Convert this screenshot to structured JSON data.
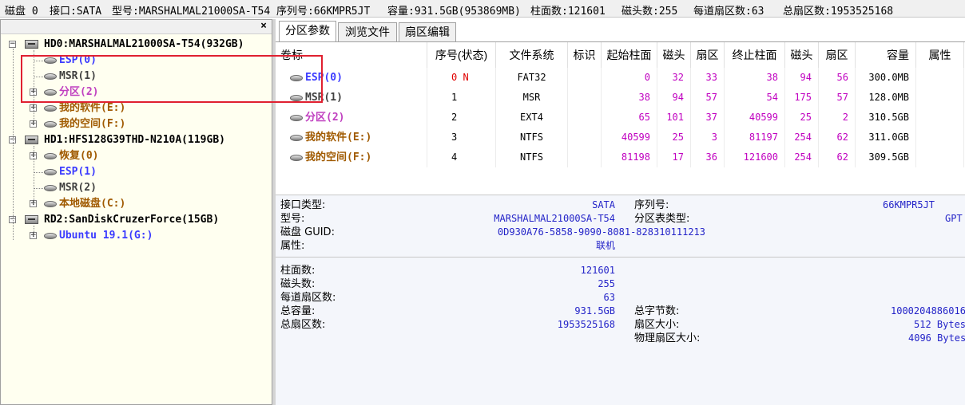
{
  "infobar": {
    "disk": "磁盘 0",
    "interface": "接口:SATA",
    "model": "型号:MARSHALMAL21000SA-T54",
    "serial": "序列号:66KMPR5JT",
    "capacity": "容量:931.5GB(953869MB)",
    "cylinders": "柱面数:121601",
    "heads": "磁头数:255",
    "sectors_per_track": "每道扇区数:63",
    "total_sectors": "总扇区数:1953525168"
  },
  "tree": {
    "close": "×",
    "disks": [
      {
        "label": "HD0:MARSHALMAL21000SA-T54(932GB)",
        "children": [
          {
            "label": "ESP(0)",
            "color": "#3a3aff"
          },
          {
            "label": "MSR(1)",
            "color": "#404040"
          },
          {
            "label": "分区(2)",
            "color": "#c040c0"
          },
          {
            "label": "我的软件(E:)",
            "color": "#a05a00"
          },
          {
            "label": "我的空间(F:)",
            "color": "#a05a00"
          }
        ]
      },
      {
        "label": "HD1:HFS128G39THD-N210A(119GB)",
        "children": [
          {
            "label": "恢复(0)",
            "color": "#a05a00"
          },
          {
            "label": "ESP(1)",
            "color": "#3a3aff"
          },
          {
            "label": "MSR(2)",
            "color": "#404040"
          },
          {
            "label": "本地磁盘(C:)",
            "color": "#a05a00"
          }
        ]
      },
      {
        "label": "RD2:SanDiskCruzerForce(15GB)",
        "children": [
          {
            "label": "Ubuntu 19.1(G:)",
            "color": "#3a3aff"
          }
        ]
      }
    ]
  },
  "tabs": [
    "分区参数",
    "浏览文件",
    "扇区编辑"
  ],
  "table": {
    "headers": [
      "卷标",
      "序号(状态)",
      "文件系统",
      "标识",
      "起始柱面",
      "磁头",
      "扇区",
      "终止柱面",
      "磁头",
      "扇区",
      "容量",
      "属性"
    ],
    "rows": [
      {
        "label": "ESP(0)",
        "label_color": "#3a3aff",
        "index": "0 N",
        "index_color": "#e00000",
        "fs": "FAT32",
        "id": "",
        "start_cyl": "0",
        "start_head": "32",
        "start_sec": "33",
        "end_cyl": "38",
        "end_head": "94",
        "end_sec": "56",
        "size": "300.0MB",
        "attr": ""
      },
      {
        "label": "MSR(1)",
        "label_color": "#404040",
        "index": "1",
        "index_color": "#000000",
        "fs": "MSR",
        "id": "",
        "start_cyl": "38",
        "start_head": "94",
        "start_sec": "57",
        "end_cyl": "54",
        "end_head": "175",
        "end_sec": "57",
        "size": "128.0MB",
        "attr": ""
      },
      {
        "label": "分区(2)",
        "label_color": "#c040c0",
        "index": "2",
        "index_color": "#000000",
        "fs": "EXT4",
        "id": "",
        "start_cyl": "65",
        "start_head": "101",
        "start_sec": "37",
        "end_cyl": "40599",
        "end_head": "25",
        "end_sec": "2",
        "size": "310.5GB",
        "attr": ""
      },
      {
        "label": "我的软件(E:)",
        "label_color": "#a05a00",
        "index": "3",
        "index_color": "#000000",
        "fs": "NTFS",
        "id": "",
        "start_cyl": "40599",
        "start_head": "25",
        "start_sec": "3",
        "end_cyl": "81197",
        "end_head": "254",
        "end_sec": "62",
        "size": "311.0GB",
        "attr": ""
      },
      {
        "label": "我的空间(F:)",
        "label_color": "#a05a00",
        "index": "4",
        "index_color": "#000000",
        "fs": "NTFS",
        "id": "",
        "start_cyl": "81198",
        "start_head": "17",
        "start_sec": "36",
        "end_cyl": "121600",
        "end_head": "254",
        "end_sec": "62",
        "size": "309.5GB",
        "attr": ""
      }
    ]
  },
  "details": {
    "interface_type_label": "接口类型:",
    "interface_type_value": "SATA",
    "model_label": "型号:",
    "model_value": "MARSHALMAL21000SA-T54",
    "guid_label": "磁盘 GUID:",
    "guid_value": "0D930A76-5858-9090-8081-828310111213",
    "attribute_label": "属性:",
    "attribute_value": "联机",
    "serial_label": "序列号:",
    "serial_value": "66KMPR5JT",
    "table_type_label": "分区表类型:",
    "table_type_value": "GPT",
    "cylinders_label": "柱面数:",
    "cylinders_value": "121601",
    "heads_label": "磁头数:",
    "heads_value": "255",
    "spt_label": "每道扇区数:",
    "spt_value": "63",
    "total_capacity_label": "总容量:",
    "total_capacity_value": "931.5GB",
    "total_sectors_label": "总扇区数:",
    "total_sectors_value": "1953525168",
    "total_bytes_label": "总字节数:",
    "total_bytes_value": "1000204886016",
    "sector_size_label": "扇区大小:",
    "sector_size_value": "512 Bytes",
    "phys_sector_label": "物理扇区大小:",
    "phys_sector_value": "4096 Bytes"
  }
}
